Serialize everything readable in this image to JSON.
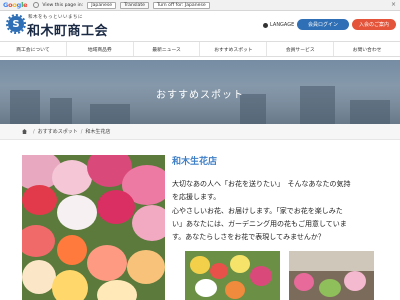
{
  "translate_bar": {
    "logo_letters": [
      "G",
      "o",
      "o",
      "g",
      "l",
      "e"
    ],
    "prompt": "View this page in:",
    "language_select": "Japanese",
    "translate_button": "Translate",
    "turn_off": "Turn off for: Japanese",
    "close": "×"
  },
  "header": {
    "logo_glyph": "S",
    "tagline": "和木をもっといいまちに",
    "site_title": "和木町商工会",
    "language_label": "LANGAGE",
    "member_login": "会員ログイン",
    "join": "入会のご案内"
  },
  "nav": {
    "items": [
      "商工会について",
      "地域商品券",
      "最新ニュース",
      "おすすめスポット",
      "会員サービス",
      "お問い合わせ"
    ]
  },
  "hero": {
    "title": "おすすめスポット"
  },
  "breadcrumb": {
    "items": [
      "おすすめスポット",
      "和木生花店"
    ],
    "separator": "/"
  },
  "content": {
    "shop_name": "和木生花店",
    "description_lines": [
      "大切なあの人へ「お花を送りたい」　そんなあなたの気持",
      "を応援します。",
      "心やさしいお花、お届けします。「家でお花を楽しみた",
      "い」あなたには、ガーデニング用の花もご用意していま",
      "す。あなたらしさをお花で表現してみませんか？"
    ]
  },
  "colors": {
    "brand_blue": "#2f6fb5",
    "accent_red": "#e4543a",
    "title_blue": "#3f7fc7"
  }
}
